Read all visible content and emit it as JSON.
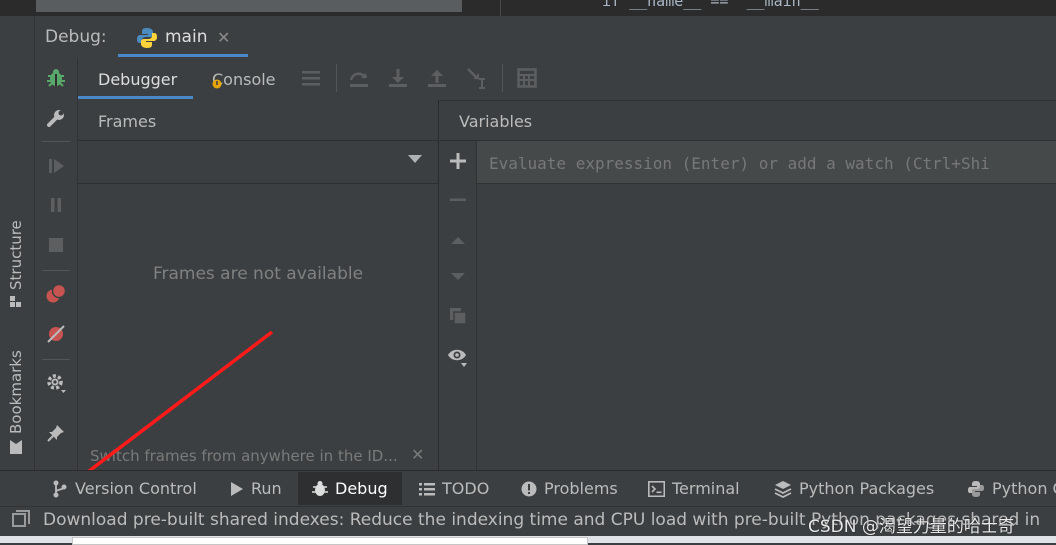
{
  "editor": {
    "code_snippet": "if __name__ == '__main__'"
  },
  "side_tabs": {
    "structure": "Structure",
    "bookmarks": "Bookmarks"
  },
  "debug_header": {
    "label": "Debug:",
    "run_config": "main"
  },
  "subtabs": {
    "debugger": "Debugger",
    "console": "Console"
  },
  "frames": {
    "title": "Frames",
    "empty_message": "Frames are not available",
    "hint": "Switch frames from anywhere in the ID..."
  },
  "variables": {
    "title": "Variables",
    "eval_placeholder": "Evaluate expression (Enter) or add a watch (Ctrl+Shi"
  },
  "bottom_tabs": [
    {
      "label": "Version Control",
      "icon": "branch-icon"
    },
    {
      "label": "Run",
      "icon": "play-icon"
    },
    {
      "label": "Debug",
      "icon": "bug-icon"
    },
    {
      "label": "TODO",
      "icon": "list-icon"
    },
    {
      "label": "Problems",
      "icon": "warning-icon"
    },
    {
      "label": "Terminal",
      "icon": "terminal-icon"
    },
    {
      "label": "Python Packages",
      "icon": "layers-icon"
    },
    {
      "label": "Python C",
      "icon": "python-icon"
    }
  ],
  "status": {
    "message": "Download pre-built shared indexes: Reduce the indexing time and CPU load with pre-built Python packages shared in",
    "watermark": "CSDN @渴望力量的哈士奇"
  },
  "colors": {
    "accent": "#4a88c7",
    "bug_green": "#59a869",
    "red": "#c75450",
    "arrow": "#ff1a1a"
  }
}
